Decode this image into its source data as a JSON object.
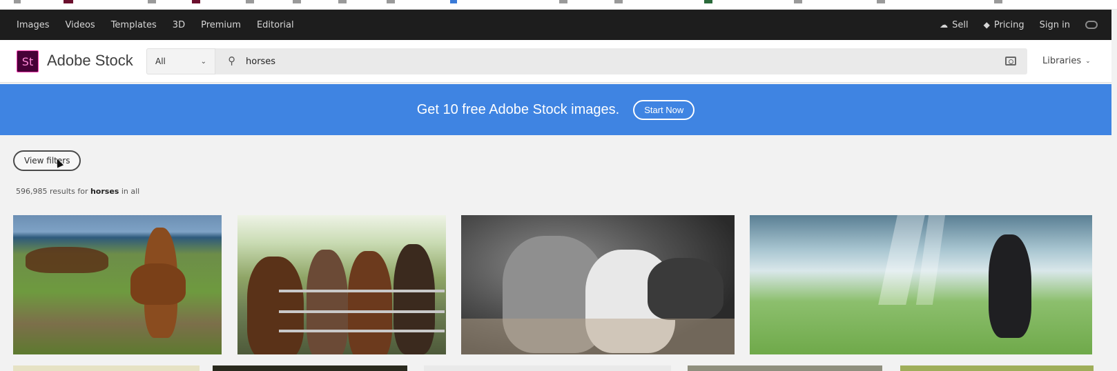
{
  "global_nav": {
    "items": [
      "Images",
      "Videos",
      "Templates",
      "3D",
      "Premium",
      "Editorial"
    ],
    "sell": "Sell",
    "pricing": "Pricing",
    "sign_in": "Sign in"
  },
  "header": {
    "logo_mark": "St",
    "logo_text": "Adobe Stock",
    "type_select": "All",
    "search_value": "horses",
    "libraries": "Libraries"
  },
  "promo": {
    "text": "Get 10 free Adobe Stock images.",
    "button": "Start Now"
  },
  "filters": {
    "view_filters": "View filters"
  },
  "results": {
    "count": "596,985",
    "mid": " results for ",
    "query": "horses",
    "suffix": " in all"
  },
  "icons": {
    "sell": "cloud-upload-icon",
    "pricing": "tag-icon",
    "search": "search-icon",
    "camera": "camera-icon",
    "cc": "creative-cloud-icon"
  },
  "colors": {
    "nav_bg": "#1d1d1d",
    "promo_bg": "#3f84e2",
    "logo_bg": "#470137"
  }
}
